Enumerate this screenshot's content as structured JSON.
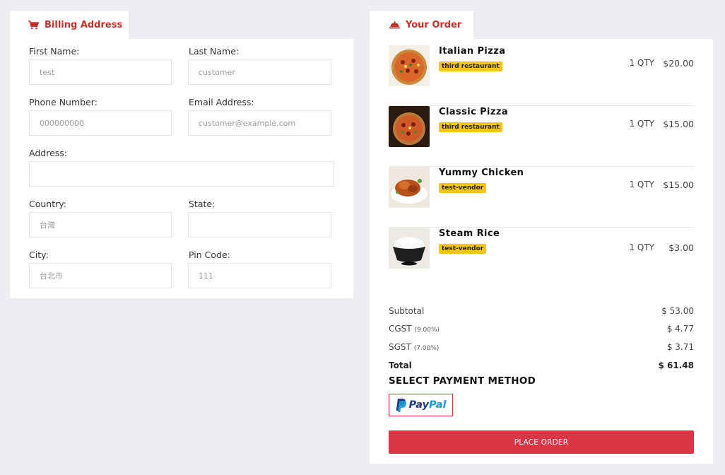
{
  "billing": {
    "tab_label": "Billing Address",
    "fields": {
      "first_name": {
        "label": "First Name:",
        "value": "test"
      },
      "last_name": {
        "label": "Last Name:",
        "value": "customer"
      },
      "phone": {
        "label": "Phone Number:",
        "value": "000000000"
      },
      "email": {
        "label": "Email Address:",
        "value": "customer@example.com"
      },
      "address": {
        "label": "Address:",
        "value": ""
      },
      "country": {
        "label": "Country:",
        "value": "台灣"
      },
      "state": {
        "label": "State:",
        "value": ""
      },
      "city": {
        "label": "City:",
        "value": "台北市"
      },
      "pin": {
        "label": "Pin Code:",
        "value": "111"
      }
    }
  },
  "order": {
    "tab_label": "Your Order",
    "items": [
      {
        "name": "Italian Pizza",
        "vendor": "third restaurant",
        "qty": "1 QTY",
        "price": "$20.00",
        "thumb": "pizza-thumb"
      },
      {
        "name": "Classic Pizza",
        "vendor": "third restaurant",
        "qty": "1 QTY",
        "price": "$15.00",
        "thumb": "pizza-thumb"
      },
      {
        "name": "Yummy Chicken",
        "vendor": "test-vendor",
        "qty": "1 QTY",
        "price": "$15.00",
        "thumb": "chicken-thumb"
      },
      {
        "name": "Steam Rice",
        "vendor": "test-vendor",
        "qty": "1 QTY",
        "price": "$3.00",
        "thumb": "rice-thumb"
      }
    ],
    "summary": {
      "subtotal_label": "Subtotal",
      "subtotal_value": "$ 53.00",
      "cgst_label": "CGST",
      "cgst_rate": "(9.00%)",
      "cgst_value": "$ 4.77",
      "sgst_label": "SGST",
      "sgst_rate": "(7.00%)",
      "sgst_value": "$ 3.71",
      "total_label": "Total",
      "total_value": "$ 61.48"
    },
    "payment_heading": "SELECT PAYMENT METHOD",
    "paypal_part1": "Pay",
    "paypal_part2": "Pal",
    "place_order_label": "PLACE ORDER"
  },
  "colors": {
    "accent_red": "#dc3545",
    "tab_red": "#c9302c",
    "badge_yellow": "#f5c518",
    "page_bg": "#eceef2"
  },
  "icons": {
    "billing_tab": "cart-icon",
    "order_tab": "cloche-icon"
  }
}
